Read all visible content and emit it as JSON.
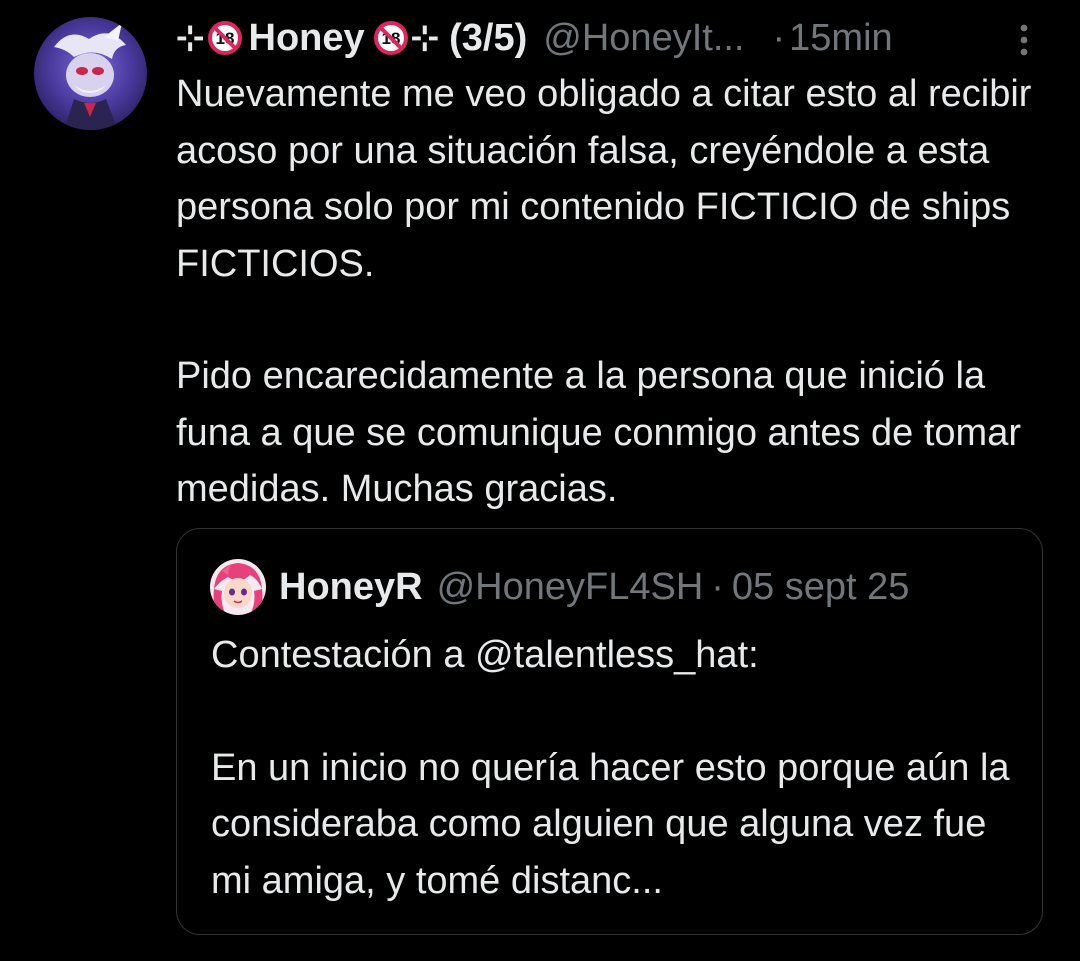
{
  "tweet": {
    "display_name_prefix": "⊹",
    "display_name": "Honey",
    "display_name_suffix": "⊹",
    "thread_index": "(3/5)",
    "handle": "@HoneyIt...",
    "separator": "·",
    "time": "15min",
    "paragraphs": [
      "Nuevamente me veo obligado a citar esto al recibir acoso por una situación falsa, creyéndole a esta persona solo por mi contenido FICTICIO de ships FICTICIOS.",
      "Pido encarecidamente a la persona que inició la funa a que se comunique conmigo antes de tomar medidas. Muchas gracias."
    ],
    "badge_icon": "no-under-18-icon",
    "more_icon": "more-options-icon"
  },
  "quoted_tweet": {
    "display_name": "HoneyR",
    "handle": "@HoneyFL4SH",
    "separator": "·",
    "date": "05 sept 25",
    "reply_to": "Contestación a @talentless_hat:",
    "text": "En un inicio no quería hacer esto porque aún la consideraba como alguien que alguna vez fue mi amiga, y tomé distanc..."
  },
  "colors": {
    "background": "#000000",
    "primary_text": "#e7e9ea",
    "secondary_text": "#71767b",
    "border": "#2f3336",
    "badge_red": "#e0245e"
  }
}
